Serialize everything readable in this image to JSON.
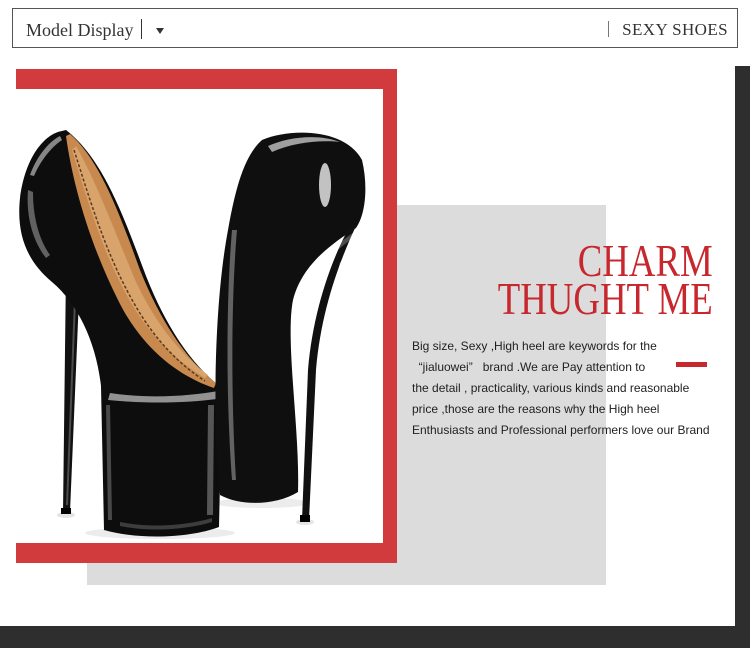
{
  "header": {
    "model_label": "Model Display",
    "dropdown_icon": "chevron-down-icon",
    "brand": "SEXY SHOES"
  },
  "hero": {
    "headline": [
      "CHARM",
      "THUGHT ME"
    ],
    "description": [
      "Big size, Sexy ,High heel are keywords for the",
      "  “jialuowei”   brand .We are Pay attention to",
      "the detail , practicality, various kinds and reasonable",
      "price ,those are the reasons why the High heel",
      "Enthusiasts and Professional performers love our Brand"
    ]
  },
  "colors": {
    "accent_red": "#d23b3d",
    "headline_red": "#c6282e",
    "panel_gray": "#dcdcdc",
    "frame_dark": "#2e2e2e",
    "border": "#555555",
    "text": "#1f1f1f"
  }
}
